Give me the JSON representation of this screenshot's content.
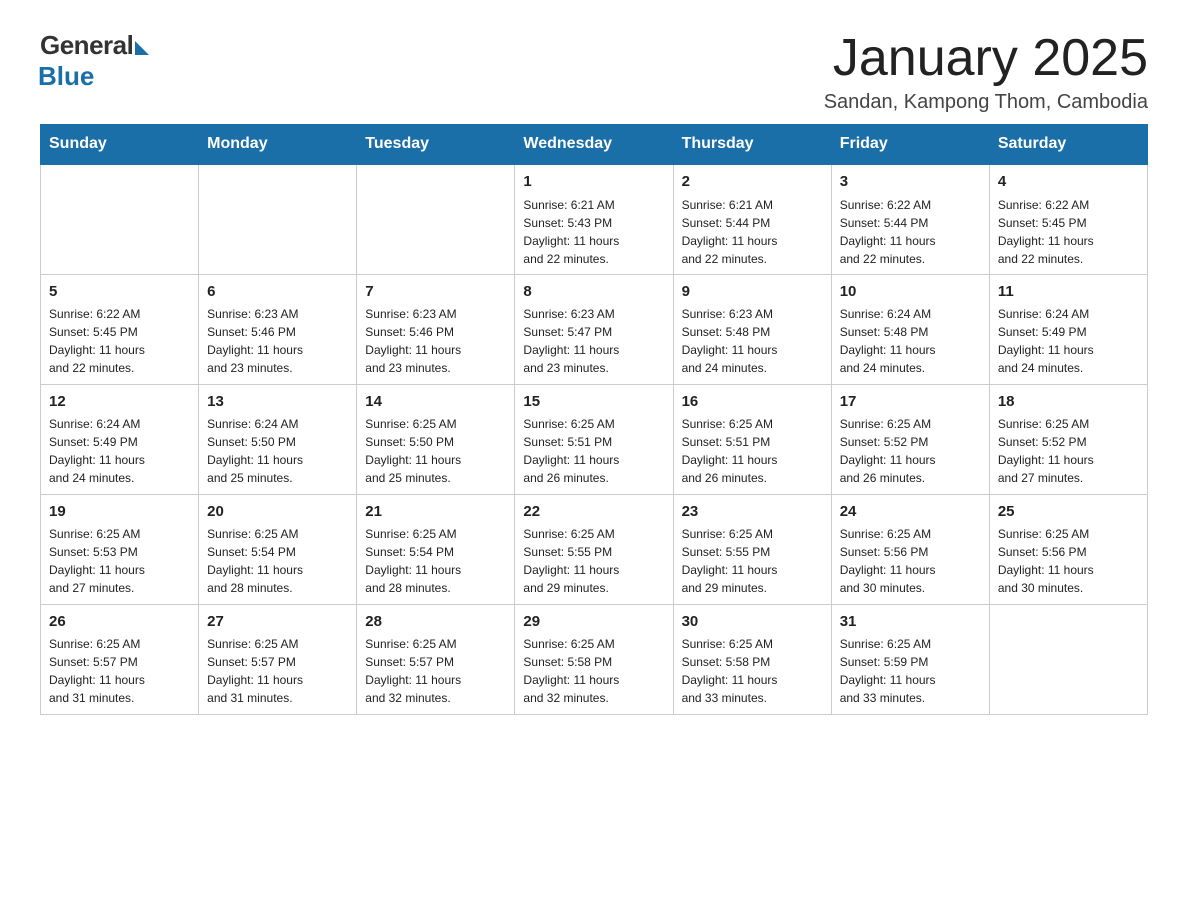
{
  "logo": {
    "general": "General",
    "blue": "Blue"
  },
  "title": "January 2025",
  "subtitle": "Sandan, Kampong Thom, Cambodia",
  "days_of_week": [
    "Sunday",
    "Monday",
    "Tuesday",
    "Wednesday",
    "Thursday",
    "Friday",
    "Saturday"
  ],
  "weeks": [
    [
      {
        "day": "",
        "info": ""
      },
      {
        "day": "",
        "info": ""
      },
      {
        "day": "",
        "info": ""
      },
      {
        "day": "1",
        "info": "Sunrise: 6:21 AM\nSunset: 5:43 PM\nDaylight: 11 hours\nand 22 minutes."
      },
      {
        "day": "2",
        "info": "Sunrise: 6:21 AM\nSunset: 5:44 PM\nDaylight: 11 hours\nand 22 minutes."
      },
      {
        "day": "3",
        "info": "Sunrise: 6:22 AM\nSunset: 5:44 PM\nDaylight: 11 hours\nand 22 minutes."
      },
      {
        "day": "4",
        "info": "Sunrise: 6:22 AM\nSunset: 5:45 PM\nDaylight: 11 hours\nand 22 minutes."
      }
    ],
    [
      {
        "day": "5",
        "info": "Sunrise: 6:22 AM\nSunset: 5:45 PM\nDaylight: 11 hours\nand 22 minutes."
      },
      {
        "day": "6",
        "info": "Sunrise: 6:23 AM\nSunset: 5:46 PM\nDaylight: 11 hours\nand 23 minutes."
      },
      {
        "day": "7",
        "info": "Sunrise: 6:23 AM\nSunset: 5:46 PM\nDaylight: 11 hours\nand 23 minutes."
      },
      {
        "day": "8",
        "info": "Sunrise: 6:23 AM\nSunset: 5:47 PM\nDaylight: 11 hours\nand 23 minutes."
      },
      {
        "day": "9",
        "info": "Sunrise: 6:23 AM\nSunset: 5:48 PM\nDaylight: 11 hours\nand 24 minutes."
      },
      {
        "day": "10",
        "info": "Sunrise: 6:24 AM\nSunset: 5:48 PM\nDaylight: 11 hours\nand 24 minutes."
      },
      {
        "day": "11",
        "info": "Sunrise: 6:24 AM\nSunset: 5:49 PM\nDaylight: 11 hours\nand 24 minutes."
      }
    ],
    [
      {
        "day": "12",
        "info": "Sunrise: 6:24 AM\nSunset: 5:49 PM\nDaylight: 11 hours\nand 24 minutes."
      },
      {
        "day": "13",
        "info": "Sunrise: 6:24 AM\nSunset: 5:50 PM\nDaylight: 11 hours\nand 25 minutes."
      },
      {
        "day": "14",
        "info": "Sunrise: 6:25 AM\nSunset: 5:50 PM\nDaylight: 11 hours\nand 25 minutes."
      },
      {
        "day": "15",
        "info": "Sunrise: 6:25 AM\nSunset: 5:51 PM\nDaylight: 11 hours\nand 26 minutes."
      },
      {
        "day": "16",
        "info": "Sunrise: 6:25 AM\nSunset: 5:51 PM\nDaylight: 11 hours\nand 26 minutes."
      },
      {
        "day": "17",
        "info": "Sunrise: 6:25 AM\nSunset: 5:52 PM\nDaylight: 11 hours\nand 26 minutes."
      },
      {
        "day": "18",
        "info": "Sunrise: 6:25 AM\nSunset: 5:52 PM\nDaylight: 11 hours\nand 27 minutes."
      }
    ],
    [
      {
        "day": "19",
        "info": "Sunrise: 6:25 AM\nSunset: 5:53 PM\nDaylight: 11 hours\nand 27 minutes."
      },
      {
        "day": "20",
        "info": "Sunrise: 6:25 AM\nSunset: 5:54 PM\nDaylight: 11 hours\nand 28 minutes."
      },
      {
        "day": "21",
        "info": "Sunrise: 6:25 AM\nSunset: 5:54 PM\nDaylight: 11 hours\nand 28 minutes."
      },
      {
        "day": "22",
        "info": "Sunrise: 6:25 AM\nSunset: 5:55 PM\nDaylight: 11 hours\nand 29 minutes."
      },
      {
        "day": "23",
        "info": "Sunrise: 6:25 AM\nSunset: 5:55 PM\nDaylight: 11 hours\nand 29 minutes."
      },
      {
        "day": "24",
        "info": "Sunrise: 6:25 AM\nSunset: 5:56 PM\nDaylight: 11 hours\nand 30 minutes."
      },
      {
        "day": "25",
        "info": "Sunrise: 6:25 AM\nSunset: 5:56 PM\nDaylight: 11 hours\nand 30 minutes."
      }
    ],
    [
      {
        "day": "26",
        "info": "Sunrise: 6:25 AM\nSunset: 5:57 PM\nDaylight: 11 hours\nand 31 minutes."
      },
      {
        "day": "27",
        "info": "Sunrise: 6:25 AM\nSunset: 5:57 PM\nDaylight: 11 hours\nand 31 minutes."
      },
      {
        "day": "28",
        "info": "Sunrise: 6:25 AM\nSunset: 5:57 PM\nDaylight: 11 hours\nand 32 minutes."
      },
      {
        "day": "29",
        "info": "Sunrise: 6:25 AM\nSunset: 5:58 PM\nDaylight: 11 hours\nand 32 minutes."
      },
      {
        "day": "30",
        "info": "Sunrise: 6:25 AM\nSunset: 5:58 PM\nDaylight: 11 hours\nand 33 minutes."
      },
      {
        "day": "31",
        "info": "Sunrise: 6:25 AM\nSunset: 5:59 PM\nDaylight: 11 hours\nand 33 minutes."
      },
      {
        "day": "",
        "info": ""
      }
    ]
  ]
}
